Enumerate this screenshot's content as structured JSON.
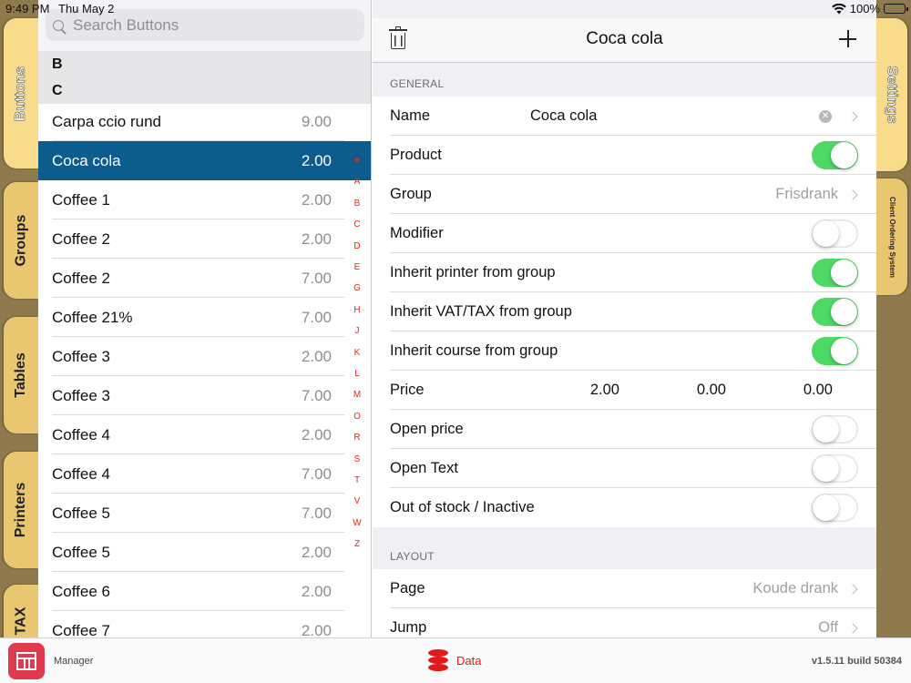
{
  "status_bar": {
    "time": "9:49 PM",
    "date": "Thu May 2",
    "battery": "100%"
  },
  "left_tabs": [
    "Buttons",
    "Groups",
    "Tables",
    "Printers",
    "TAX"
  ],
  "right_tabs": [
    "Settings",
    "Client Ordering System"
  ],
  "search": {
    "placeholder": "Search Buttons"
  },
  "list": {
    "sections": [
      "B",
      "C"
    ],
    "items": [
      {
        "name": "Carpa ccio rund",
        "price": "9.00"
      },
      {
        "name": "Coca cola",
        "price": "2.00",
        "selected": true
      },
      {
        "name": "Coffee 1",
        "price": "2.00"
      },
      {
        "name": "Coffee 2",
        "price": "2.00"
      },
      {
        "name": "Coffee 2",
        "price": "7.00"
      },
      {
        "name": "Coffee 21%",
        "price": "7.00"
      },
      {
        "name": "Coffee 3",
        "price": "2.00"
      },
      {
        "name": "Coffee 3",
        "price": "7.00"
      },
      {
        "name": "Coffee 4",
        "price": "2.00"
      },
      {
        "name": "Coffee 4",
        "price": "7.00"
      },
      {
        "name": "Coffee 5",
        "price": "7.00"
      },
      {
        "name": "Coffee 5",
        "price": "2.00"
      },
      {
        "name": "Coffee 6",
        "price": "2.00"
      },
      {
        "name": "Coffee 7",
        "price": "2.00"
      }
    ],
    "index_letters": [
      "★",
      "A",
      "B",
      "C",
      "D",
      "E",
      "G",
      "H",
      "J",
      "K",
      "L",
      "M",
      "O",
      "R",
      "S",
      "T",
      "V",
      "W",
      "Z"
    ]
  },
  "detail": {
    "title": "Coca cola",
    "general_header": "GENERAL",
    "layout_header": "LAYOUT",
    "general_rows": [
      {
        "label": "Name",
        "kind": "text",
        "value": "Coca cola"
      },
      {
        "label": "Product",
        "kind": "toggle",
        "on": true
      },
      {
        "label": "Group",
        "kind": "link",
        "value": "Frisdrank"
      },
      {
        "label": "Modifier",
        "kind": "toggle",
        "on": false
      },
      {
        "label": "Inherit printer from group",
        "kind": "toggle",
        "on": true
      },
      {
        "label": "Inherit VAT/TAX from group",
        "kind": "toggle",
        "on": true
      },
      {
        "label": "Inherit course from group",
        "kind": "toggle",
        "on": true
      },
      {
        "label": "Price",
        "kind": "prices",
        "values": [
          "2.00",
          "0.00",
          "0.00"
        ]
      },
      {
        "label": "Open price",
        "kind": "toggle",
        "on": false
      },
      {
        "label": "Open Text",
        "kind": "toggle",
        "on": false
      },
      {
        "label": "Out of stock / Inactive",
        "kind": "toggle",
        "on": false
      }
    ],
    "layout_rows": [
      {
        "label": "Page",
        "kind": "link",
        "value": "Koude drank"
      },
      {
        "label": "Jump",
        "kind": "link",
        "value": "Off"
      }
    ]
  },
  "bottom_bar": {
    "app_label": "Manager",
    "data_label": "Data",
    "version": "v1.5.11 build 50384"
  },
  "colors": {
    "selection": "#0c5d8e",
    "toggle_on": "#4cd964",
    "accent_red": "#e0191b",
    "tab_tan": "#e9c771"
  }
}
